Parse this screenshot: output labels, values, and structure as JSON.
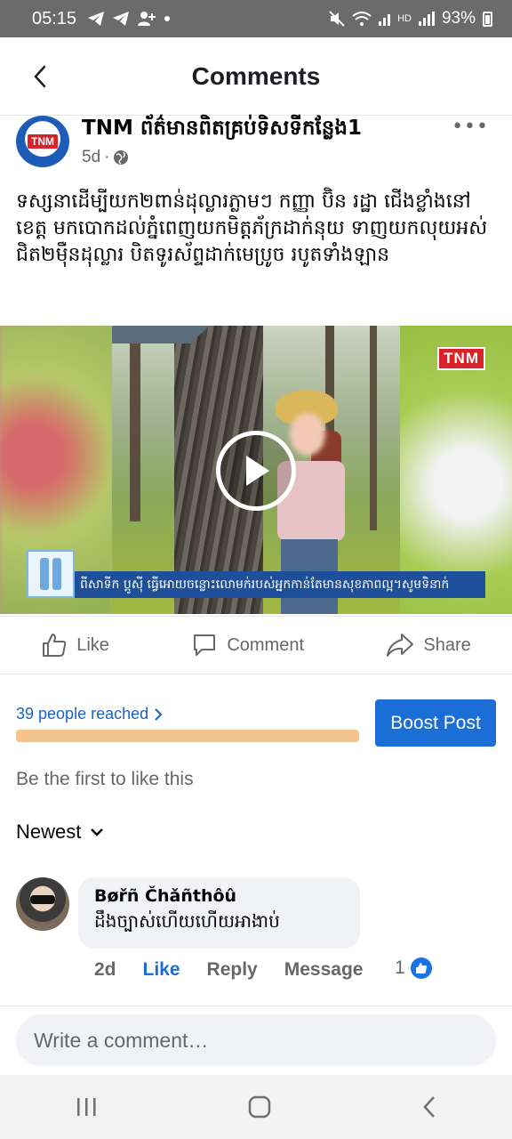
{
  "status_bar": {
    "time": "05:15",
    "network_label": "HD",
    "battery": "93%"
  },
  "header": {
    "title": "Comments"
  },
  "post": {
    "page_name": "TNM ព័ត៌មានពិតគ្រប់ទិសទីកន្លែង1",
    "time": "5d",
    "avatar_label": "TNM",
    "text": "ទស្សនាដើម្បីយក២ពាន់ដុល្លារភ្លាមៗ កញ្ញា ប៊ិន រដ្ឋា ជើងខ្លាំងនៅខេត្ត មកបោកដល់ភ្នំពេញយកមិត្តភ័ក្រដាក់នុយ ទាញយកលុយអស់ជិត២ម៉ឺនដុល្លារ បិតទូរស័ព្ទដាក់មេប្រូច របូតទាំងឡាន",
    "video": {
      "badge": "TNM",
      "ticker": "ពីសាទីក ប្ដូស៊ី ធ្វើអោយចន្លោះលោមក់របស់អ្នកកាន់តែមានសុខភាពល្អ។សូមទិនាក់"
    }
  },
  "actions": {
    "like": "Like",
    "comment": "Comment",
    "share": "Share"
  },
  "reach": {
    "text": "39 people reached",
    "progress": 1.0,
    "boost_label": "Boost Post"
  },
  "first_like": "Be the first to like this",
  "sort": {
    "label": "Newest"
  },
  "comment": {
    "author": "Bøřñ Čhǎñthôû",
    "text": "ដឹងច្បាស់ហើយហើយអាងាប់",
    "time": "2d",
    "like": "Like",
    "reply": "Reply",
    "message": "Message",
    "reaction_count": "1"
  },
  "composer": {
    "placeholder": "Write a comment…"
  },
  "colors": {
    "accent": "#1b6ed6",
    "progress": "#f5c48c",
    "status_bar": "#6b6b6b"
  }
}
